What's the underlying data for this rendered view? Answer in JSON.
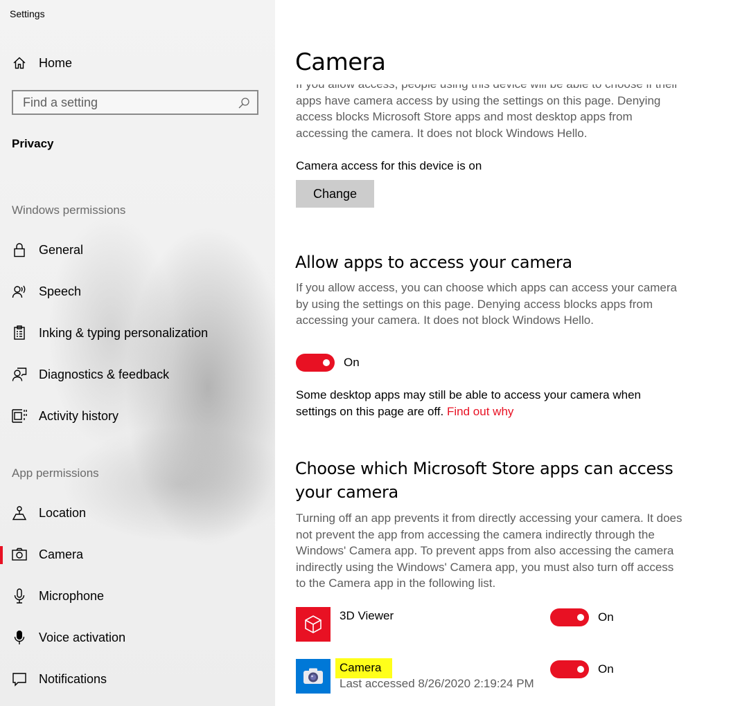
{
  "window": {
    "title": "Settings"
  },
  "sidebar": {
    "home_label": "Home",
    "search_placeholder": "Find a setting",
    "category": "Privacy",
    "windows_permissions_header": "Windows permissions",
    "windows_permissions": [
      {
        "label": "General",
        "icon": "lock-icon"
      },
      {
        "label": "Speech",
        "icon": "speech-icon"
      },
      {
        "label": "Inking & typing personalization",
        "icon": "clipboard-icon"
      },
      {
        "label": "Diagnostics & feedback",
        "icon": "diagnostics-icon"
      },
      {
        "label": "Activity history",
        "icon": "activity-history-icon"
      }
    ],
    "app_permissions_header": "App permissions",
    "app_permissions": [
      {
        "label": "Location",
        "icon": "location-icon"
      },
      {
        "label": "Camera",
        "icon": "camera-icon",
        "active": true
      },
      {
        "label": "Microphone",
        "icon": "microphone-icon"
      },
      {
        "label": "Voice activation",
        "icon": "voice-activation-icon"
      },
      {
        "label": "Notifications",
        "icon": "notifications-icon"
      }
    ]
  },
  "main": {
    "title": "Camera",
    "intro_text": "If you allow access, people using this device will be able to choose if their apps have camera access by using the settings on this page. Denying access blocks Microsoft Store apps and most desktop apps from accessing the camera. It does not block Windows Hello.",
    "device_access_status": "Camera access for this device is on",
    "change_button": "Change",
    "allow_apps": {
      "heading": "Allow apps to access your camera",
      "description": "If you allow access, you can choose which apps can access your camera by using the settings on this page. Denying access blocks apps from accessing your camera. It does not block Windows Hello.",
      "toggle_state": "On",
      "desktop_note": "Some desktop apps may still be able to access your camera when settings on this page are off.",
      "find_out_link": "Find out why"
    },
    "store_apps": {
      "heading_line1": "Choose which Microsoft Store apps can access",
      "heading_line2": "your camera",
      "description": "Turning off an app prevents it from directly accessing your camera. It does not prevent the app from accessing the camera indirectly through the Windows' Camera app. To prevent apps from also accessing the camera indirectly using the Windows' Camera app, you must also turn off access to the Camera app in the following list.",
      "apps": [
        {
          "name": "3D Viewer",
          "state": "On",
          "icon": "3d-viewer-icon",
          "tile_color": "#e81123"
        },
        {
          "name": "Camera",
          "subtitle": "Last accessed 8/26/2020 2:19:24 PM",
          "state": "On",
          "icon": "camera-app-icon",
          "tile_color": "#0078d7",
          "highlighted": true
        }
      ]
    }
  },
  "colors": {
    "accent": "#e81123",
    "highlight": "#ffff1a",
    "secondary_text": "#5d5d5d"
  }
}
